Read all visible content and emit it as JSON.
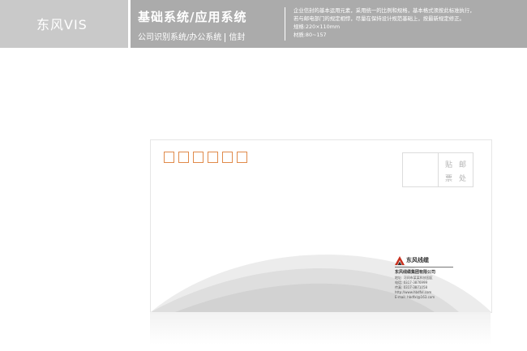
{
  "header": {
    "brand": "东风VIS",
    "title": "基础系统/应用系统",
    "subtitle_left": "公司识别系统/办公系统",
    "subtitle_right": "信封",
    "desc_lines": [
      "企业信封的基本运用元素，采用统一的比例和规格，基本格式须按此标准执行，",
      "若与邮电部门的规定相悖，尽量在保持设计规范基础上，按最新规定修正。",
      "规格:220×110mm",
      "材质:80~157"
    ]
  },
  "envelope": {
    "postcode_boxes": 6,
    "stamp_line1": "贴邮",
    "stamp_line2": "票处",
    "logo_name": "东风线缆",
    "company_name": "东风线缆集团有限公司",
    "address_lines": [
      "地址: 河间市某某科技园区",
      "电话: 0317-3876999",
      "传真: 0317-3871058",
      "http://www.hbdfxl.com",
      "E-mail: hbdfxl@163.com"
    ]
  },
  "colors": {
    "header_bg": "#ababab",
    "brand_bg": "#c9c9c9",
    "postcode_border": "#e08a4a",
    "logo_red": "#c8301e"
  }
}
